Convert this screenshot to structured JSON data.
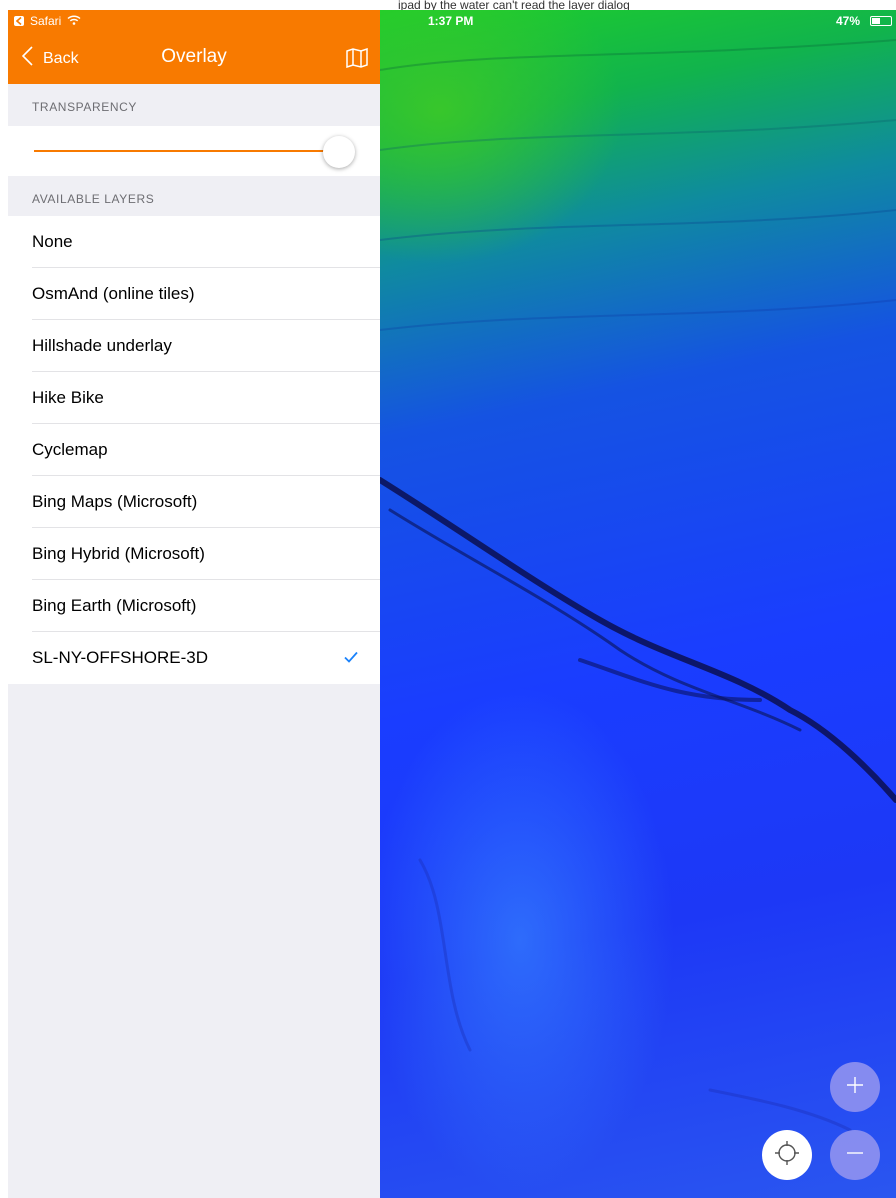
{
  "caption_text": "ipad by the water can't read the layer dialog",
  "status_bar": {
    "back_app": "Safari",
    "time": "1:37 PM",
    "battery": "47%",
    "battery_level": 0.47
  },
  "nav": {
    "back_label": "Back",
    "title": "Overlay",
    "map_icon": "map-icon"
  },
  "transparency": {
    "header": "TRANSPARENCY",
    "value": 1.0
  },
  "layers": {
    "header": "AVAILABLE LAYERS",
    "items": [
      {
        "label": "None",
        "selected": false
      },
      {
        "label": "OsmAnd (online tiles)",
        "selected": false
      },
      {
        "label": "Hillshade underlay",
        "selected": false
      },
      {
        "label": "Hike Bike",
        "selected": false
      },
      {
        "label": "Cyclemap",
        "selected": false
      },
      {
        "label": "Bing Maps (Microsoft)",
        "selected": false
      },
      {
        "label": "Bing Hybrid (Microsoft)",
        "selected": false
      },
      {
        "label": "Bing Earth (Microsoft)",
        "selected": false
      },
      {
        "label": "SL-NY-OFFSHORE-3D",
        "selected": true
      }
    ]
  },
  "colors": {
    "accent": "#f87a00",
    "check": "#1a82fb"
  },
  "map_controls": {
    "zoom_in_icon": "plus-icon",
    "zoom_out_icon": "minus-icon",
    "locate_icon": "location-crosshair-icon"
  }
}
